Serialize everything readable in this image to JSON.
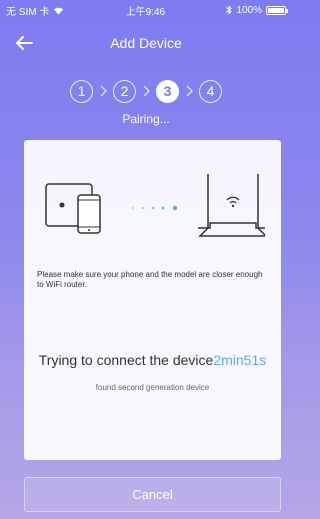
{
  "status_bar": {
    "carrier": "无 SIM 卡",
    "time": "上午9:46",
    "battery": "100%",
    "icons": [
      "wifi-icon",
      "bluetooth-icon",
      "battery-icon"
    ]
  },
  "nav": {
    "title": "Add Device",
    "back_icon": "back-arrow-icon"
  },
  "steps": {
    "items": [
      "1",
      "2",
      "3",
      "4"
    ],
    "active_index": 2,
    "label": "Pairing..."
  },
  "card": {
    "instructions": "Please make sure your phone and the model are closer enough to WiFi router.",
    "trying_text": "Trying to connect the device",
    "timer": "2min51s",
    "found_text": "found second generation device"
  },
  "cancel_label": "Cancel",
  "colors": {
    "accent": "#7b79ee",
    "timer": "#5aa9ef",
    "dots": "#6ab4f2"
  }
}
